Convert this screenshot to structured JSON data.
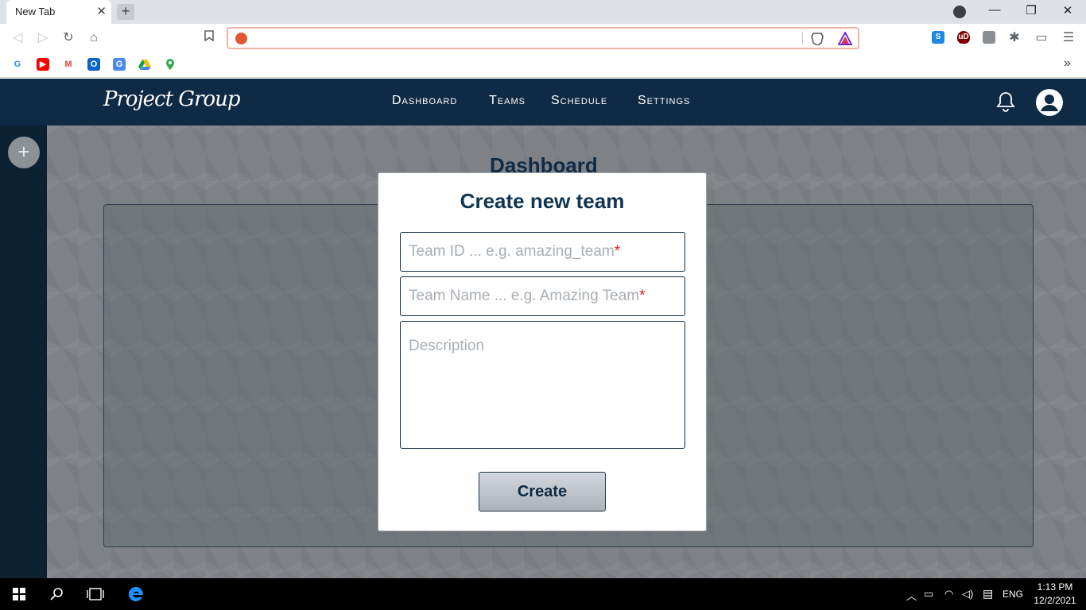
{
  "browser": {
    "tab_title": "New Tab",
    "tab_close": "✕",
    "new_tab": "+",
    "window_controls": {
      "minimize": "—",
      "restore": "❐",
      "close": "✕"
    },
    "bookmarks_overflow": "»"
  },
  "app": {
    "logo": "Project Group",
    "nav": [
      "Dashboard",
      "Teams",
      "Schedule",
      "Settings"
    ],
    "add_button": "+"
  },
  "dashboard": {
    "title": "Dashboard"
  },
  "modal": {
    "title": "Create new team",
    "team_id_placeholder": "Team ID ... e.g. amazing_team",
    "team_name_placeholder": "Team Name ... e.g. Amazing Team",
    "required_marker": "*",
    "description_placeholder": "Description",
    "create_label": "Create"
  },
  "taskbar": {
    "language": "ENG",
    "time": "1:13 PM",
    "date": "12/2/2021"
  },
  "colors": {
    "nav_bg": "#0f2a44",
    "accent": "#0f3552",
    "required": "#d92020"
  }
}
